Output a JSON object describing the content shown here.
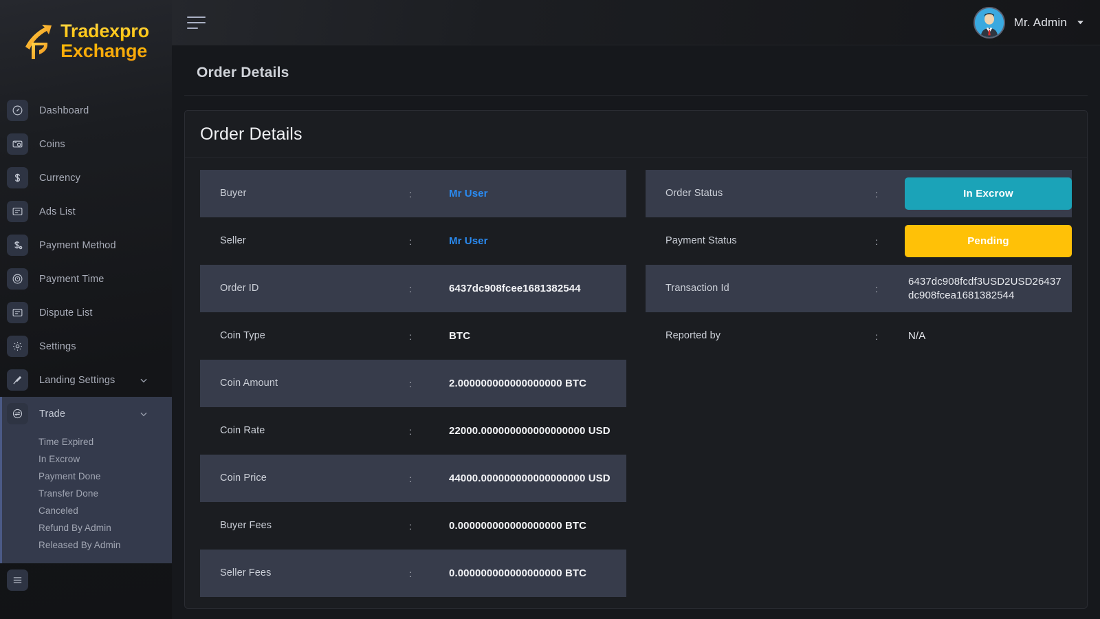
{
  "brand": {
    "line1": "Tradexpro",
    "line2": "Exchange",
    "logo_icon": "upward-arrow-logo-icon",
    "color": "#ffc107"
  },
  "sidebar": {
    "items": [
      {
        "label": "Dashboard",
        "icon": "speedometer-icon"
      },
      {
        "label": "Coins",
        "icon": "coin-stack-icon"
      },
      {
        "label": "Currency",
        "icon": "dollar-sign-icon"
      },
      {
        "label": "Ads List",
        "icon": "list-card-icon"
      },
      {
        "label": "Payment Method",
        "icon": "dollar-gear-icon"
      },
      {
        "label": "Payment Time",
        "icon": "clock-badge-icon"
      },
      {
        "label": "Dispute List",
        "icon": "list-card-icon"
      },
      {
        "label": "Settings",
        "icon": "gear-icon"
      }
    ],
    "landing": {
      "label": "Landing Settings",
      "icon": "hammer-icon",
      "caret": "chevron-down-icon"
    },
    "trade": {
      "label": "Trade",
      "icon": "exchange-arrows-icon",
      "caret": "chevron-down-icon",
      "active": true,
      "submenu": [
        "Time Expired",
        "In Excrow",
        "Payment Done",
        "Transfer Done",
        "Canceled",
        "Refund By Admin",
        "Released By Admin"
      ]
    },
    "partial_item": {
      "label": "",
      "icon": "menu-icon"
    }
  },
  "header": {
    "menu_toggle_icon": "hamburger-icon",
    "user_name": "Mr. Admin",
    "avatar_icon": "user-avatar-icon",
    "caret_icon": "chevron-down-icon"
  },
  "page": {
    "title": "Order Details"
  },
  "card": {
    "title": "Order Details",
    "separator": ":",
    "left_rows": [
      {
        "label": "Buyer",
        "value": "Mr User",
        "style": "link"
      },
      {
        "label": "Seller",
        "value": "Mr User",
        "style": "link"
      },
      {
        "label": "Order ID",
        "value": "6437dc908fcee1681382544",
        "style": "bold"
      },
      {
        "label": "Coin Type",
        "value": "BTC",
        "style": "bold"
      },
      {
        "label": "Coin Amount",
        "value": "2.000000000000000000 BTC",
        "style": "bold"
      },
      {
        "label": "Coin Rate",
        "value": "22000.000000000000000000 USD",
        "style": "bold"
      },
      {
        "label": "Coin Price",
        "value": "44000.000000000000000000 USD",
        "style": "bold"
      },
      {
        "label": "Buyer Fees",
        "value": "0.000000000000000000 BTC",
        "style": "bold"
      },
      {
        "label": "Seller Fees",
        "value": "0.000000000000000000 BTC",
        "style": "bold"
      }
    ],
    "right_rows": [
      {
        "label": "Order Status",
        "value": "In Excrow",
        "style": "badge",
        "color": "#1ba3b8"
      },
      {
        "label": "Payment Status",
        "value": "Pending",
        "style": "badge",
        "color": "#ffc107"
      },
      {
        "label": "Transaction Id",
        "value": "6437dc908fcdf3USD2USD26437dc908fcea1681382544",
        "style": "plain"
      },
      {
        "label": "Reported by",
        "value": "N/A",
        "style": "plain"
      }
    ]
  }
}
